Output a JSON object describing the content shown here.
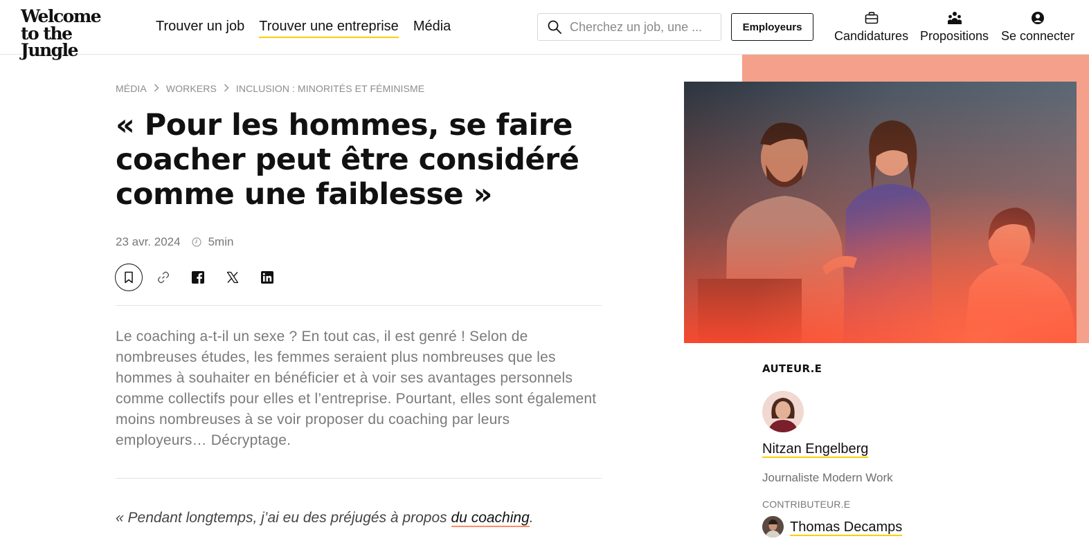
{
  "header": {
    "logo_line1": "Welcome",
    "logo_line2": "to the Jungle",
    "nav": [
      {
        "label": "Trouver un job"
      },
      {
        "label": "Trouver une entreprise",
        "active": true
      },
      {
        "label": "Média"
      }
    ],
    "search_placeholder": "Cherchez un job, une ...",
    "employers_button": "Employeurs",
    "items": [
      {
        "label": "Candidatures",
        "icon": "briefcase-icon"
      },
      {
        "label": "Propositions",
        "icon": "people-icon"
      },
      {
        "label": "Se connecter",
        "icon": "user-icon"
      }
    ]
  },
  "breadcrumb": [
    "MÉDIA",
    "WORKERS",
    "INCLUSION : MINORITÉS ET FÉMINISME"
  ],
  "article": {
    "title": "« Pour les hommes, se faire coacher peut être considéré comme une faiblesse »",
    "date": "23 avr. 2024",
    "read_time": "5min",
    "lead": "Le coaching a-t-il un sexe ? En tout cas, il est genré ! Selon de nombreuses études, les femmes seraient plus nombreuses que les hommes à souhaiter en bénéficier et à voir ses avantages personnels comme collectifs pour elles et l’entreprise. Pourtant, elles sont également moins nombreuses à se voir proposer du coaching par leurs employeurs… Décryptage.",
    "quote_prefix": "« Pendant longtemps, j’ai eu des préjugés à propos ",
    "quote_link": "du coaching",
    "quote_suffix": "."
  },
  "share_icons": [
    "bookmark-icon",
    "link-icon",
    "facebook-icon",
    "x-icon",
    "linkedin-icon"
  ],
  "sidebar": {
    "author_heading": "AUTEUR.E",
    "author_name": "Nitzan Engelberg",
    "author_role": "Journaliste Modern Work",
    "contrib_heading": "CONTRIBUTEUR.E",
    "contrib_name": "Thomas Decamps"
  },
  "colors": {
    "accent_yellow": "#ffcd00",
    "accent_salmon": "#f5a08a",
    "link_underline": "#ff8a65"
  }
}
